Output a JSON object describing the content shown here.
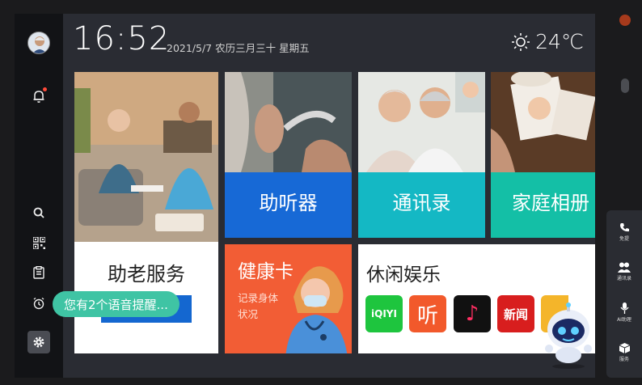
{
  "status": {
    "time": "16:52",
    "date": "2021/5/7 农历三月三十 星期五",
    "temperature": "24℃",
    "weather_icon": "sun-icon"
  },
  "tiles": {
    "hearing_aid": "助听器",
    "contacts": "通讯录",
    "family_album": "家庭相册",
    "elder_service": "助老服务",
    "health_card": {
      "title": "健康卡",
      "subtitle_line1": "记录身体",
      "subtitle_line2": "状况"
    },
    "leisure": "休闲娱乐"
  },
  "apps": [
    {
      "name": "iqiyi",
      "label": "iQIYI",
      "color": "#1ec53e"
    },
    {
      "name": "ting",
      "label": "听",
      "color": "#f2592b"
    },
    {
      "name": "douyin",
      "label": "♪",
      "color": "#111111"
    },
    {
      "name": "news",
      "label": "新闻",
      "color": "#d81e1e"
    }
  ],
  "toast": "您有2个语音提醒...",
  "right_panel": [
    {
      "icon": "phone-icon",
      "label": "免提"
    },
    {
      "icon": "contacts-icon",
      "label": "通讯录"
    },
    {
      "icon": "microphone-icon",
      "label": "AI助理"
    },
    {
      "icon": "box-icon",
      "label": "服务"
    }
  ],
  "colors": {
    "hearing_aid": "#1769d6",
    "contacts": "#14b8c4",
    "family_album": "#14bfa6",
    "health_card": "#f25d35",
    "toast": "#3fc4a4"
  }
}
